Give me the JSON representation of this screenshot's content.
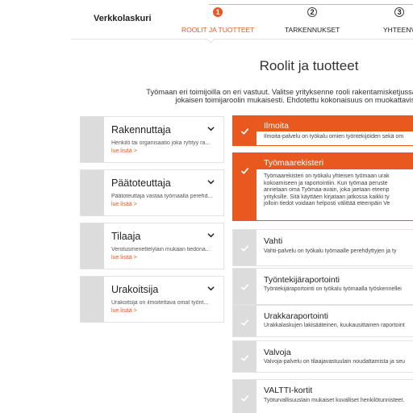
{
  "header": {
    "app_title": "Verkkolaskuri",
    "steps": [
      {
        "num": "1",
        "label": "ROOLIT JA TUOTTEET"
      },
      {
        "num": "2",
        "label": "TARKENNUKSET"
      },
      {
        "num": "3",
        "label": "YHTEENV"
      }
    ]
  },
  "main": {
    "title": "Roolit ja tuotteet",
    "intro": [
      "Työmaan eri toimijoilla on eri vastuut. Valitse yrityksenne rooli rakentamisketjussa. Laskuri ehdotta",
      "jokaisen toimijaroolin mukaisesti. Ehdotettu kokonaisuus on muokattavissa toivei"
    ]
  },
  "roles": [
    {
      "name": "Rakennuttaja",
      "desc": "Henkilö tai organisaatio joka ryhtyy ra...",
      "more": "lue lisää >"
    },
    {
      "name": "Päätoteuttaja",
      "desc": "Päätoteuttaja vastaa työmaalla perehd...",
      "more": "lue lisää >"
    },
    {
      "name": "Tilaaja",
      "desc": "Verotusmenettelylain mukaan tiedona...",
      "more": "lue lisää >"
    },
    {
      "name": "Urakoitsija",
      "desc": "Urakoitsija on ilmoitettava omat työnt...",
      "more": "lue lisää >"
    }
  ],
  "products": [
    {
      "name": "Ilmoita",
      "selected": true,
      "desc": [
        "Ilmoita-palvelu on työkalu omien työntekijöiden sekä om"
      ]
    },
    {
      "name": "Työmaarekisteri",
      "selected": true,
      "desc": [
        "Työmaarekisteri on työkalu yhteisen työmaan urak",
        "kokoamiseen ja raportointiin. Kun työmaa peruste",
        "annetaan oma Työmaa-avain, joka jaetaan eteenp",
        "yrityksille. Sitä käyttäen kirjataan jatkossa kaikki ty",
        "jolloin tiedot voidaan helposti välittää eteenpäin Ve"
      ]
    },
    {
      "name": "Vahti",
      "selected": false,
      "desc": [
        "Vahti-palvelu on työkalu työmaalle perehdyttyjen ja ty"
      ]
    },
    {
      "name": "Työntekijäraportointi",
      "selected": false,
      "desc": [
        "Työntekijäraportointi on työkalu työmaalla työskennellei"
      ]
    },
    {
      "name": "Urakkaraportointi",
      "selected": false,
      "desc": [
        "Urakkalaskujen lakisääteinen, kuukausittainen raportoint"
      ]
    },
    {
      "name": "Valvoja",
      "selected": false,
      "desc": [
        "Valvoja-palvelu on tilaajavastuulain noudattamista ja seu"
      ]
    },
    {
      "name": "VALTTI-kortit",
      "selected": false,
      "desc": [
        "Työturvallisuuslain mukaiset kuvalliset henkilötunnisteet."
      ]
    }
  ],
  "colors": {
    "accent": "#e8581f",
    "strip": "#dcdcdc"
  }
}
